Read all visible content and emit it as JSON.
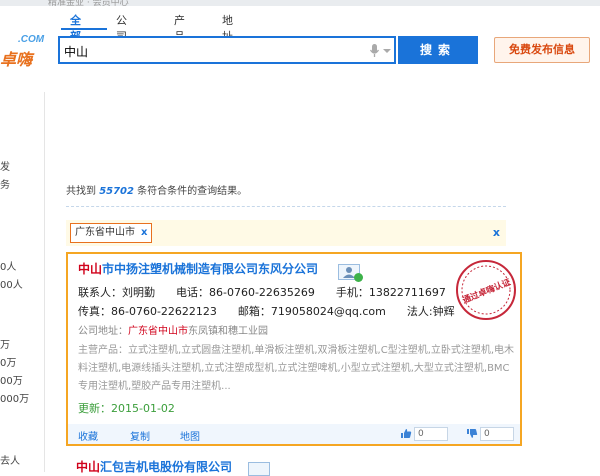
{
  "topbar": {
    "text": "精准金业 · 会员中心"
  },
  "logo": {
    "com": ".COM",
    "brand": "卓嗨"
  },
  "tabs": [
    {
      "label": "全部",
      "active": true
    },
    {
      "label": "公司名",
      "active": false
    },
    {
      "label": "产品",
      "active": false
    },
    {
      "label": "地址",
      "active": false
    }
  ],
  "search": {
    "value": "中山",
    "button": "搜索"
  },
  "publish_button": "免费发布信息",
  "left_fragments": [
    "发",
    "务",
    "0人",
    "00人",
    "万",
    "0万",
    "00万",
    "000万",
    "去人"
  ],
  "results": {
    "prefix": "共找到",
    "count": "55702",
    "suffix": "条符合条件的查询结果。"
  },
  "filter": {
    "tag": "广东省中山市",
    "tag_close": "x",
    "close": "x"
  },
  "card": {
    "title_hl": "中山",
    "title_rest": "市中扬注塑机械制造有限公司东风分公司",
    "contact": "联系人：刘明勤",
    "phone": "电话：86-0760-22635269",
    "mobile": "手机：13822711697",
    "fax": "传真：86-0760-22622123",
    "email": "邮箱：719058024@qq.com",
    "legal": "法人:钟辉",
    "addr_label": "公司地址：",
    "addr_hl": "广东省中山市",
    "addr_rest": "东凤镇和穗工业园",
    "products": "主营产品：立式注塑机,立式圆盘注塑机,单滑板注塑机,双滑板注塑机,C型注塑机,立卧式注塑机,电木料注塑机,电源线插头注塑机,立式注塑成型机,立式注塑啤机,小型立式注塑机,大型立式注塑机,BMC专用注塑机,塑胶产品专用注塑机...",
    "updated": "更新：2015-01-02",
    "seal_text": "通过卓嗨认证",
    "links": [
      "收藏",
      "复制",
      "地图"
    ],
    "votes": [
      "0",
      "0"
    ]
  },
  "next_card": {
    "title_hl": "中山",
    "title_rest": "汇包吉机电股份有限公司"
  }
}
